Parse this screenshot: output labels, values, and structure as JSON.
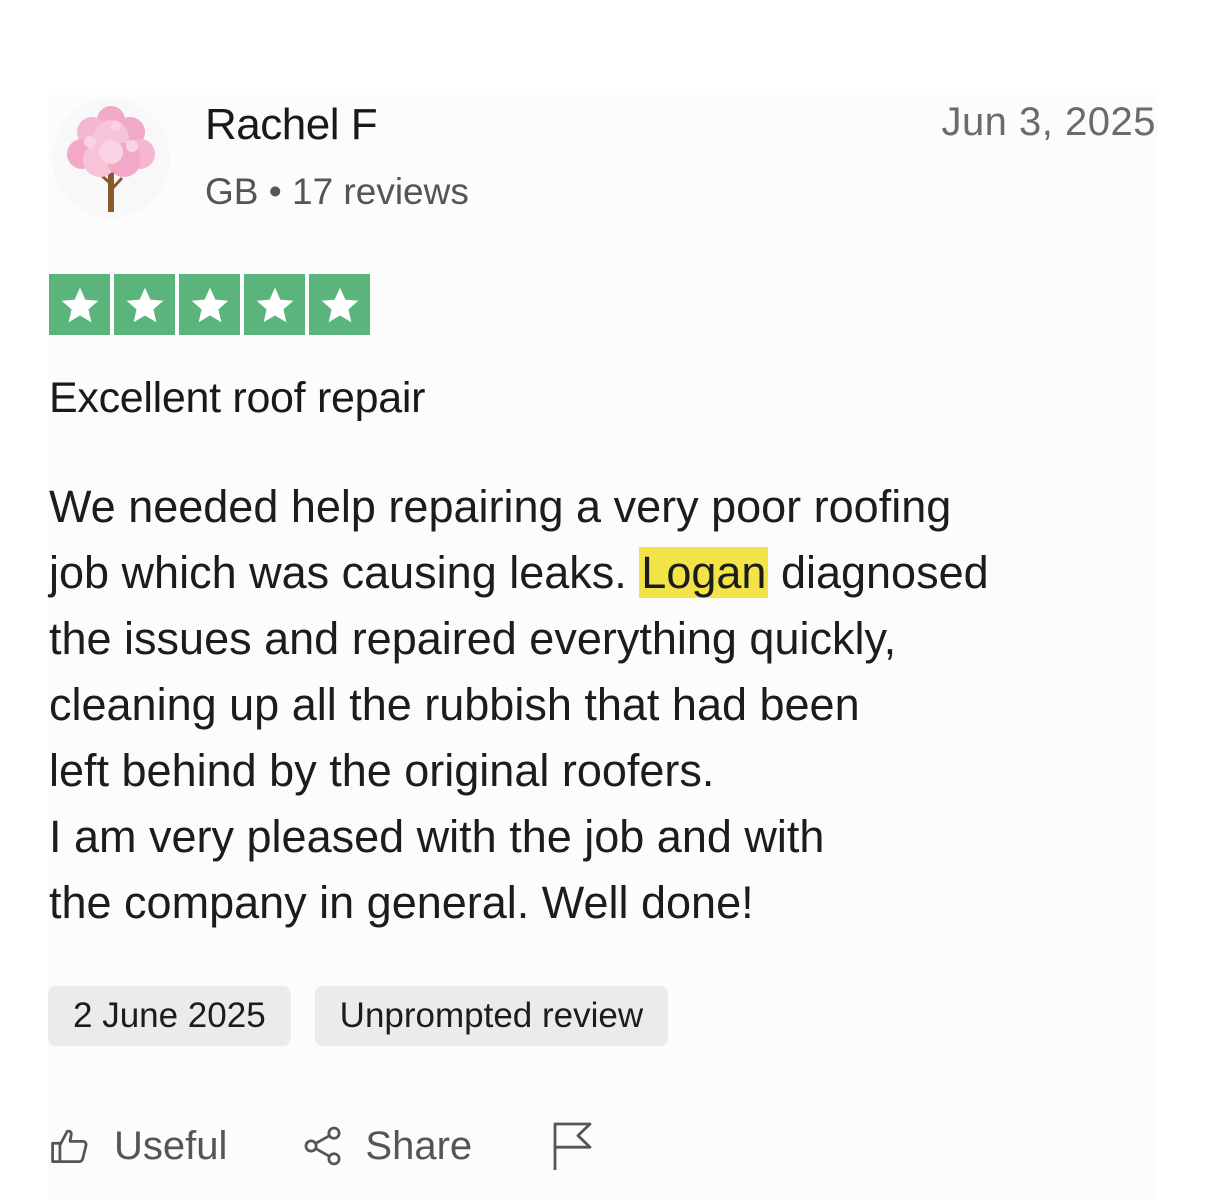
{
  "reviewer": {
    "name": "Rachel F",
    "country": "GB",
    "separator": "•",
    "reviews_count": "17 reviews",
    "avatar_icon": "cherry-blossom-tree-icon"
  },
  "review": {
    "date_top": "Jun 3, 2025",
    "rating": 5,
    "rating_max": 5,
    "star_color": "#5bb47c",
    "title": "Excellent roof repair",
    "body_lines": {
      "l1": "We needed help repairing a very poor roofing",
      "l2_before": "job which was causing leaks. ",
      "l2_highlight": "Logan",
      "l2_after": " diagnosed",
      "l3": "the issues and repaired everything quickly,",
      "l4": "cleaning up all the rubbish that had been",
      "l5": "left behind by the original roofers.",
      "l6": "I am very pleased with the job and with",
      "l7": "the company in general. Well done!"
    },
    "highlight_color": "#f2e447",
    "experience_date": "2 June 2025",
    "review_type": "Unprompted review"
  },
  "actions": {
    "useful_label": "Useful",
    "useful_icon": "thumbs-up-icon",
    "share_label": "Share",
    "share_icon": "share-icon",
    "report_icon": "flag-icon"
  }
}
